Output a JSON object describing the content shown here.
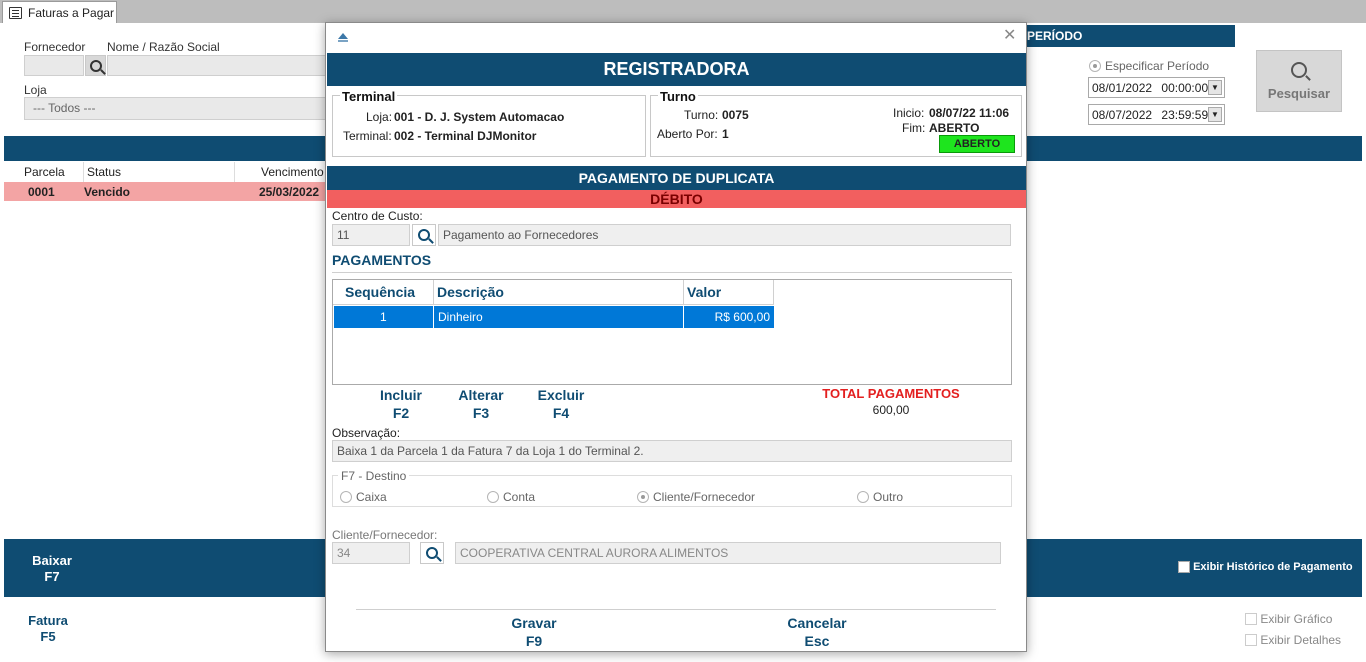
{
  "tab": {
    "label": "Faturas a Pagar"
  },
  "filters": {
    "fornecedor_label": "Fornecedor",
    "nome_label": "Nome / Razão Social",
    "loja_label": "Loja",
    "loja_value": "--- Todos ---",
    "periodo_title": "PERÍODO",
    "especificar_label": "Especificar Período",
    "date_from": "08/01/2022",
    "time_from": "00:00:00",
    "date_to": "08/07/2022",
    "time_to": "23:59:59",
    "pesquisar_label": "Pesquisar"
  },
  "grid": {
    "headers": [
      "Parcela",
      "Status",
      "Vencimento"
    ],
    "rows": [
      {
        "parcela": "0001",
        "status": "Vencido",
        "vencimento": "25/03/2022"
      }
    ]
  },
  "bottom": {
    "baixar": "Baixar",
    "baixar_key": "F7",
    "historico": "Exibir Histórico de Pagamento",
    "fatura": "Fatura",
    "fatura_key": "F5",
    "grafico": "Exibir Gráfico",
    "detalhes": "Exibir Detalhes"
  },
  "modal": {
    "title": "REGISTRADORA",
    "terminal": {
      "title": "Terminal",
      "loja_label": "Loja:",
      "loja_value": "001 - D. J. System Automacao",
      "terminal_label": "Terminal:",
      "terminal_value": "002 - Terminal DJMonitor"
    },
    "turno": {
      "title": "Turno",
      "turno_label": "Turno:",
      "turno_value": "0075",
      "aberto_label": "Aberto Por:",
      "aberto_value": "1",
      "inicio_label": "Inicio:",
      "inicio_value": "08/07/22 11:06",
      "fim_label": "Fim:",
      "fim_value": "ABERTO",
      "badge": "ABERTO"
    },
    "section": "PAGAMENTO DE DUPLICATA",
    "type": "DÉBITO",
    "centro_label": "Centro de Custo:",
    "centro_code": "11",
    "centro_desc": "Pagamento ao Fornecedores",
    "pagamentos_title": "PAGAMENTOS",
    "pag_headers": [
      "Sequência",
      "Descrição",
      "Valor"
    ],
    "pag_rows": [
      {
        "seq": "1",
        "desc": "Dinheiro",
        "valor": "R$ 600,00"
      }
    ],
    "incluir": "Incluir",
    "incluir_key": "F2",
    "alterar": "Alterar",
    "alterar_key": "F3",
    "excluir": "Excluir",
    "excluir_key": "F4",
    "total_label": "TOTAL PAGAMENTOS",
    "total_value": "600,00",
    "obs_label": "Observação:",
    "obs_value": "Baixa 1 da Parcela 1 da Fatura 7 da Loja 1 do Terminal 2.",
    "destino_title": "F7 - Destino",
    "destino_options": [
      "Caixa",
      "Conta",
      "Cliente/Fornecedor",
      "Outro"
    ],
    "cliente_label": "Cliente/Fornecedor:",
    "cliente_code": "34",
    "cliente_name": "COOPERATIVA CENTRAL AURORA ALIMENTOS",
    "gravar": "Gravar",
    "gravar_key": "F9",
    "cancelar": "Cancelar",
    "cancelar_key": "Esc"
  },
  "colors": {
    "brand": "#0f4c72",
    "debit": "#f25f5f",
    "open": "#1ee51e",
    "overdue": "#f3a4a4"
  }
}
